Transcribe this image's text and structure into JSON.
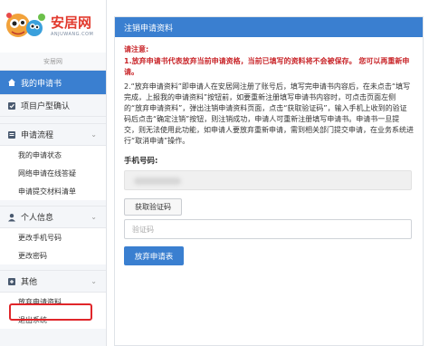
{
  "brand": {
    "title": "安居网",
    "subtitle": "ANJUWANG.COM",
    "site_label": "安居网",
    "accent": "#3a7fd0",
    "warning_color": "#c9262a"
  },
  "sidebar": {
    "active_item": "我的申请书",
    "items": [
      {
        "label": "项目户型确认",
        "icon": "checkbox-icon"
      }
    ],
    "groups": [
      {
        "label": "申请流程",
        "icon": "flow-icon",
        "children": [
          "我的申请状态",
          "网络申请在线答疑",
          "申请提交材料清单"
        ]
      },
      {
        "label": "个人信息",
        "icon": "person-icon",
        "children": [
          "更改手机号码",
          "更改密码"
        ]
      },
      {
        "label": "其他",
        "icon": "other-icon",
        "children": [
          "放弃申请资料",
          "退出系统"
        ]
      }
    ]
  },
  "panel": {
    "header": "注销申请资料",
    "note_title": "请注意:",
    "warning": "1.放弃申请书代表放弃当前申请资格，当前已填写的资料将不会被保存。 您可以再重新申请。",
    "paragraph": "2.“放弃申请资料”即申请人在安居网注册了账号后，填写完申请书内容后，在未点击“填写完成，上报我的申请资料”按钮前，如要重新注册填写申请书内容时，可点击页面左侧的“放弃申请资料”，弹出注销申请资料页面，点击“获取验证码”，输入手机上收到的验证码后点击“确定注销”按钮，则注销成功，申请人可重新注册填写申请书。申请书一旦提交，则无法使用此功能，如申请人要放弃重新申请，需到相关部门提交申请，在业务系统进行“取消申请”操作。",
    "phone_label": "手机号码:",
    "code_button": "获取验证码",
    "code_placeholder": "验证码",
    "submit_button": "放弃申请表"
  }
}
